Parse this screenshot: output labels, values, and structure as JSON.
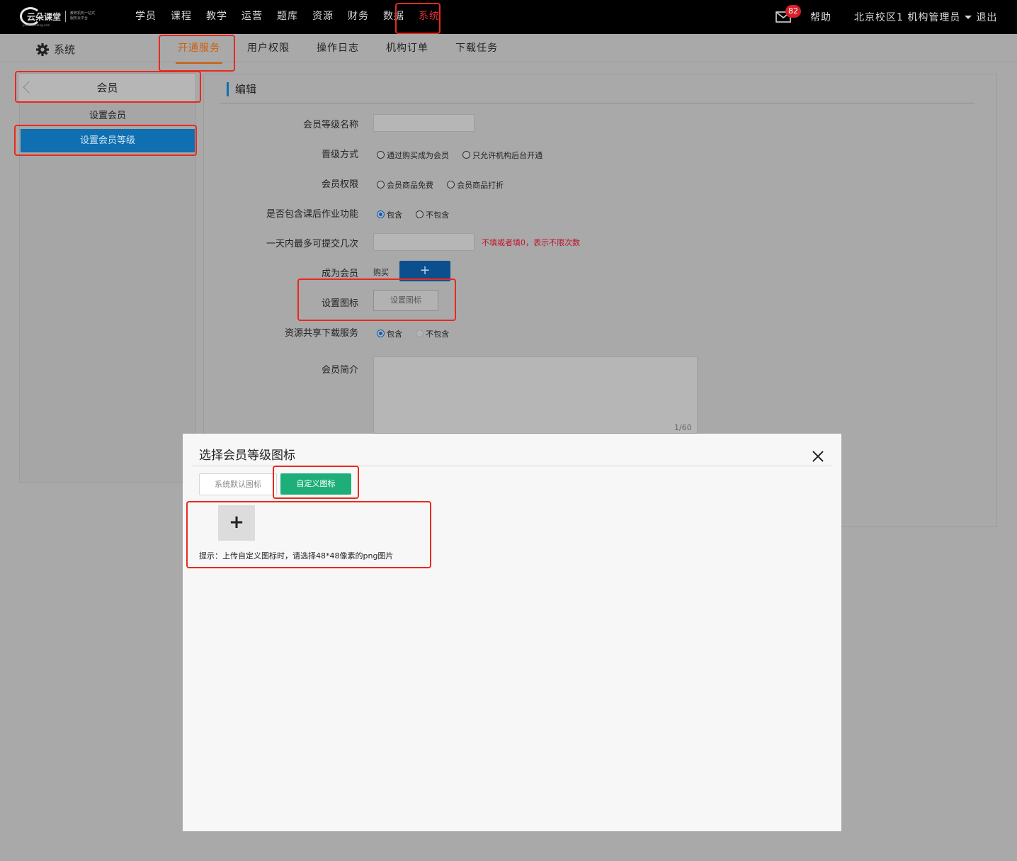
{
  "logo": {
    "text": "云朵课堂",
    "tagline": "教育机构一站式服务云平台",
    "url": "yunduoketang.com"
  },
  "nav": {
    "items": [
      "学员",
      "课程",
      "教学",
      "运营",
      "题库",
      "资源",
      "财务",
      "数据",
      "系统"
    ],
    "active": "系统"
  },
  "header": {
    "mail_count": "82",
    "help": "帮助",
    "user": "北京校区1 机构管理员",
    "logout": "退出"
  },
  "subnav": {
    "section_title": "系统",
    "tabs": [
      "开通服务",
      "用户权限",
      "操作日志",
      "机构订单",
      "下载任务"
    ],
    "active": "开通服务"
  },
  "sidebar": {
    "header": "会员",
    "items": [
      "设置会员",
      "设置会员等级"
    ],
    "active": "设置会员等级"
  },
  "form": {
    "title": "编辑",
    "name_label": "会员等级名称",
    "name_value": "",
    "upgrade_label": "晋级方式",
    "upgrade_options": [
      "通过购买成为会员",
      "只允许机构后台开通"
    ],
    "rights_label": "会员权限",
    "rights_options": [
      "会员商品免费",
      "会员商品打折"
    ],
    "homework_label": "是否包含课后作业功能",
    "homework_options": [
      "包含",
      "不包含"
    ],
    "submit_label": "一天内最多可提交几次",
    "submit_value": "",
    "submit_hint": "不填或者填0，表示不限次数",
    "become_label": "成为会员",
    "become_buy": "购买",
    "become_add": "+",
    "icon_label": "设置图标",
    "icon_button": "设置图标",
    "share_label": "资源共享下载服务",
    "share_options": [
      "包含",
      "不包含"
    ],
    "intro_label": "会员简介",
    "intro_counter": "1/60"
  },
  "modal": {
    "title": "选择会员等级图标",
    "tabs": [
      "系统默认图标",
      "自定义图标"
    ],
    "active_tab": "自定义图标",
    "upload_plus": "+",
    "hint": "提示：上传自定义图标时，请选择48*48像素的png图片"
  },
  "colors": {
    "accent_blue": "#0f6fb0",
    "accent_orange": "#d05e0c",
    "accent_green": "#1eae79",
    "highlight_red": "#e8291f"
  }
}
